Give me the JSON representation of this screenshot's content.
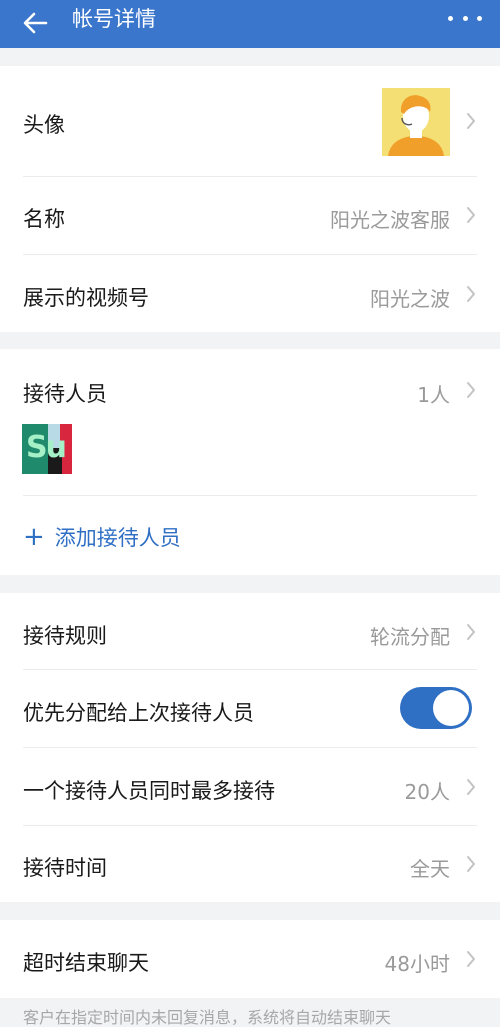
{
  "header": {
    "title": "帐号详情",
    "back_icon": "arrow-left-icon",
    "more_icon": "more-horizontal-icon",
    "bg_color": "#3a76cc"
  },
  "account": {
    "avatar_label": "头像",
    "name_label": "名称",
    "name_value": "阳光之波客服",
    "channel_label": "展示的视频号",
    "channel_value": "阳光之波"
  },
  "reception": {
    "staff_label": "接待人员",
    "staff_count": "1人",
    "add_staff_label": "添加接待人员",
    "add_icon": "plus-icon",
    "staff_avatar_text": "Su"
  },
  "rules": {
    "rule_label": "接待规则",
    "rule_value": "轮流分配",
    "priority_label": "优先分配给上次接待人员",
    "priority_enabled": true,
    "max_label": "一个接待人员同时最多接待",
    "max_value": "20人",
    "time_label": "接待时间",
    "time_value": "全天"
  },
  "timeout": {
    "label": "超时结束聊天",
    "value": "48小时",
    "note": "客户在指定时间内未回复消息，系统将自动结束聊天"
  },
  "colors": {
    "accent": "#2f6fc4",
    "page_bg": "#f2f3f5",
    "secondary_text": "#9a9a9a"
  }
}
